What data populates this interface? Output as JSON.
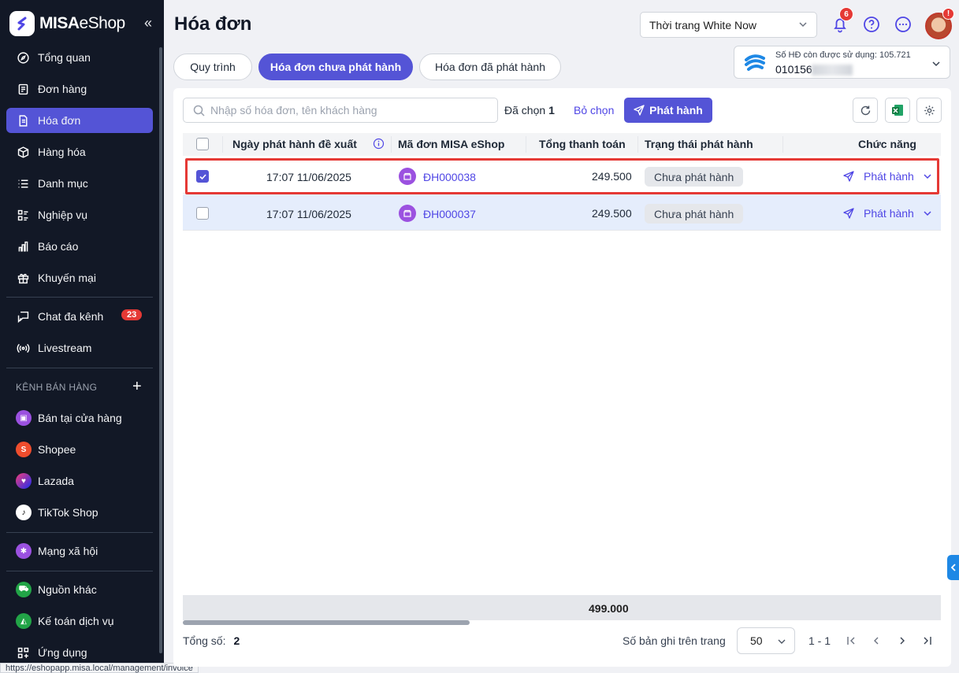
{
  "app": {
    "logo_text_bold": "MISA",
    "logo_text_light": "eShop"
  },
  "sidebar": {
    "items": [
      {
        "label": "Tổng quan",
        "icon": "compass-icon"
      },
      {
        "label": "Đơn hàng",
        "icon": "order-icon"
      },
      {
        "label": "Hóa đơn",
        "icon": "invoice-icon",
        "active": true
      },
      {
        "label": "Hàng hóa",
        "icon": "box-icon"
      },
      {
        "label": "Danh mục",
        "icon": "list-icon"
      },
      {
        "label": "Nghiệp vụ",
        "icon": "operations-icon"
      },
      {
        "label": "Báo cáo",
        "icon": "chart-icon"
      },
      {
        "label": "Khuyến mại",
        "icon": "gift-icon"
      },
      {
        "label": "Chat đa kênh",
        "icon": "chat-icon",
        "badge": "23"
      },
      {
        "label": "Livestream",
        "icon": "livestream-icon"
      }
    ],
    "section_title": "KÊNH BÁN HÀNG",
    "channels": [
      {
        "label": "Bán tại cửa hàng",
        "icon": "store-icon"
      },
      {
        "label": "Shopee",
        "icon": "shopee-icon"
      },
      {
        "label": "Lazada",
        "icon": "lazada-icon"
      },
      {
        "label": "TikTok Shop",
        "icon": "tiktok-icon"
      },
      {
        "label": "Mạng xã hội",
        "icon": "social-icon"
      },
      {
        "label": "Nguồn khác",
        "icon": "cart-icon"
      },
      {
        "label": "Kế toán dịch vụ",
        "icon": "accounting-icon"
      },
      {
        "label": "Ứng dụng",
        "icon": "apps-icon"
      }
    ]
  },
  "status_url": "https://eshopapp.misa.local/management/invoice",
  "header": {
    "title": "Hóa đơn",
    "store": "Thời trang White Now",
    "notification_count": "6",
    "avatar_alert": "!"
  },
  "tabs": [
    {
      "label": "Quy trình"
    },
    {
      "label": "Hóa đơn chưa phát hành",
      "active": true
    },
    {
      "label": "Hóa đơn đã phát hành"
    }
  ],
  "quota": {
    "line1": "Số HĐ còn được sử dụng: 105.721",
    "line2": "010156"
  },
  "toolbar": {
    "search_placeholder": "Nhập số hóa đơn, tên khách hàng",
    "selected_label": "Đã chọn",
    "selected_count": "1",
    "deselect_label": "Bỏ chọn",
    "issue_label": "Phát hành"
  },
  "table": {
    "columns": [
      "Ngày phát hành đề xuất",
      "Mã đơn MISA eShop",
      "Tổng thanh toán",
      "Trạng thái phát hành",
      "Chức năng"
    ],
    "rows": [
      {
        "checked": true,
        "date": "17:07 11/06/2025",
        "order": "ĐH000038",
        "total": "249.500",
        "status": "Chưa phát hành",
        "action": "Phát hành"
      },
      {
        "checked": false,
        "date": "17:07 11/06/2025",
        "order": "ĐH000037",
        "total": "249.500",
        "status": "Chưa phát hành",
        "action": "Phát hành"
      }
    ],
    "footer_total": "499.000"
  },
  "pagination": {
    "total_label": "Tổng số:",
    "total": "2",
    "per_page_label": "Số bản ghi trên trang",
    "per_page": "50",
    "range": "1 - 1"
  },
  "colors": {
    "accent": "#5454d6",
    "sidebar_bg": "#121826",
    "danger": "#e53935"
  }
}
